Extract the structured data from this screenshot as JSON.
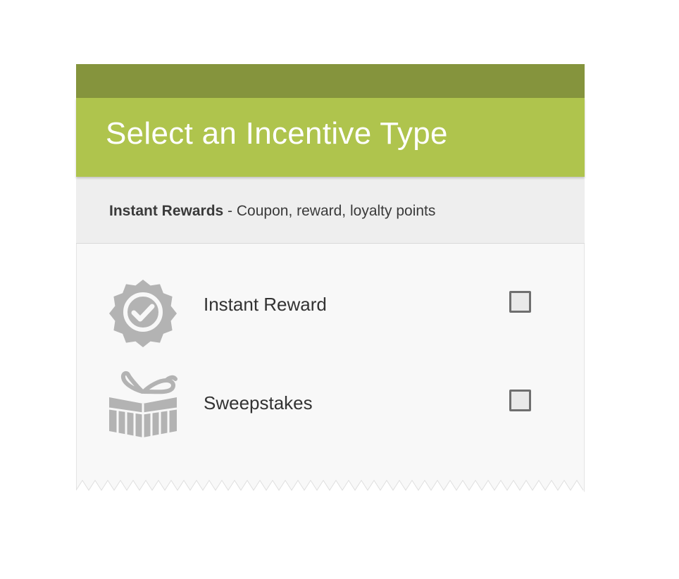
{
  "header": {
    "title": "Select an Incentive Type"
  },
  "category": {
    "name": "Instant Rewards",
    "separator": " - ",
    "description": "Coupon, reward, loyalty points"
  },
  "options": [
    {
      "label": "Instant Reward",
      "icon": "badge-check-icon",
      "checked": false
    },
    {
      "label": "Sweepstakes",
      "icon": "gift-icon",
      "checked": false
    }
  ],
  "colors": {
    "status_bar": "#85943d",
    "title_bar": "#afc44d",
    "icon": "#b3b3b3"
  }
}
